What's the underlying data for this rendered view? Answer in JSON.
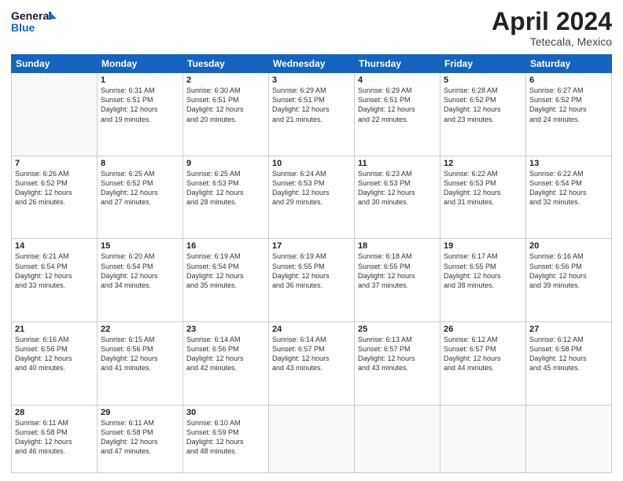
{
  "logo": {
    "line1": "General",
    "line2": "Blue"
  },
  "header": {
    "month": "April 2024",
    "location": "Tetecala, Mexico"
  },
  "weekdays": [
    "Sunday",
    "Monday",
    "Tuesday",
    "Wednesday",
    "Thursday",
    "Friday",
    "Saturday"
  ],
  "weeks": [
    [
      {
        "day": "",
        "info": ""
      },
      {
        "day": "1",
        "info": "Sunrise: 6:31 AM\nSunset: 6:51 PM\nDaylight: 12 hours\nand 19 minutes."
      },
      {
        "day": "2",
        "info": "Sunrise: 6:30 AM\nSunset: 6:51 PM\nDaylight: 12 hours\nand 20 minutes."
      },
      {
        "day": "3",
        "info": "Sunrise: 6:29 AM\nSunset: 6:51 PM\nDaylight: 12 hours\nand 21 minutes."
      },
      {
        "day": "4",
        "info": "Sunrise: 6:29 AM\nSunset: 6:51 PM\nDaylight: 12 hours\nand 22 minutes."
      },
      {
        "day": "5",
        "info": "Sunrise: 6:28 AM\nSunset: 6:52 PM\nDaylight: 12 hours\nand 23 minutes."
      },
      {
        "day": "6",
        "info": "Sunrise: 6:27 AM\nSunset: 6:52 PM\nDaylight: 12 hours\nand 24 minutes."
      }
    ],
    [
      {
        "day": "7",
        "info": "Sunrise: 6:26 AM\nSunset: 6:52 PM\nDaylight: 12 hours\nand 26 minutes."
      },
      {
        "day": "8",
        "info": "Sunrise: 6:25 AM\nSunset: 6:52 PM\nDaylight: 12 hours\nand 27 minutes."
      },
      {
        "day": "9",
        "info": "Sunrise: 6:25 AM\nSunset: 6:53 PM\nDaylight: 12 hours\nand 28 minutes."
      },
      {
        "day": "10",
        "info": "Sunrise: 6:24 AM\nSunset: 6:53 PM\nDaylight: 12 hours\nand 29 minutes."
      },
      {
        "day": "11",
        "info": "Sunrise: 6:23 AM\nSunset: 6:53 PM\nDaylight: 12 hours\nand 30 minutes."
      },
      {
        "day": "12",
        "info": "Sunrise: 6:22 AM\nSunset: 6:53 PM\nDaylight: 12 hours\nand 31 minutes."
      },
      {
        "day": "13",
        "info": "Sunrise: 6:22 AM\nSunset: 6:54 PM\nDaylight: 12 hours\nand 32 minutes."
      }
    ],
    [
      {
        "day": "14",
        "info": "Sunrise: 6:21 AM\nSunset: 6:54 PM\nDaylight: 12 hours\nand 33 minutes."
      },
      {
        "day": "15",
        "info": "Sunrise: 6:20 AM\nSunset: 6:54 PM\nDaylight: 12 hours\nand 34 minutes."
      },
      {
        "day": "16",
        "info": "Sunrise: 6:19 AM\nSunset: 6:54 PM\nDaylight: 12 hours\nand 35 minutes."
      },
      {
        "day": "17",
        "info": "Sunrise: 6:19 AM\nSunset: 6:55 PM\nDaylight: 12 hours\nand 36 minutes."
      },
      {
        "day": "18",
        "info": "Sunrise: 6:18 AM\nSunset: 6:55 PM\nDaylight: 12 hours\nand 37 minutes."
      },
      {
        "day": "19",
        "info": "Sunrise: 6:17 AM\nSunset: 6:55 PM\nDaylight: 12 hours\nand 38 minutes."
      },
      {
        "day": "20",
        "info": "Sunrise: 6:16 AM\nSunset: 6:56 PM\nDaylight: 12 hours\nand 39 minutes."
      }
    ],
    [
      {
        "day": "21",
        "info": "Sunrise: 6:16 AM\nSunset: 6:56 PM\nDaylight: 12 hours\nand 40 minutes."
      },
      {
        "day": "22",
        "info": "Sunrise: 6:15 AM\nSunset: 6:56 PM\nDaylight: 12 hours\nand 41 minutes."
      },
      {
        "day": "23",
        "info": "Sunrise: 6:14 AM\nSunset: 6:56 PM\nDaylight: 12 hours\nand 42 minutes."
      },
      {
        "day": "24",
        "info": "Sunrise: 6:14 AM\nSunset: 6:57 PM\nDaylight: 12 hours\nand 43 minutes."
      },
      {
        "day": "25",
        "info": "Sunrise: 6:13 AM\nSunset: 6:57 PM\nDaylight: 12 hours\nand 43 minutes."
      },
      {
        "day": "26",
        "info": "Sunrise: 6:12 AM\nSunset: 6:57 PM\nDaylight: 12 hours\nand 44 minutes."
      },
      {
        "day": "27",
        "info": "Sunrise: 6:12 AM\nSunset: 6:58 PM\nDaylight: 12 hours\nand 45 minutes."
      }
    ],
    [
      {
        "day": "28",
        "info": "Sunrise: 6:11 AM\nSunset: 6:58 PM\nDaylight: 12 hours\nand 46 minutes."
      },
      {
        "day": "29",
        "info": "Sunrise: 6:11 AM\nSunset: 6:58 PM\nDaylight: 12 hours\nand 47 minutes."
      },
      {
        "day": "30",
        "info": "Sunrise: 6:10 AM\nSunset: 6:59 PM\nDaylight: 12 hours\nand 48 minutes."
      },
      {
        "day": "",
        "info": ""
      },
      {
        "day": "",
        "info": ""
      },
      {
        "day": "",
        "info": ""
      },
      {
        "day": "",
        "info": ""
      }
    ]
  ]
}
